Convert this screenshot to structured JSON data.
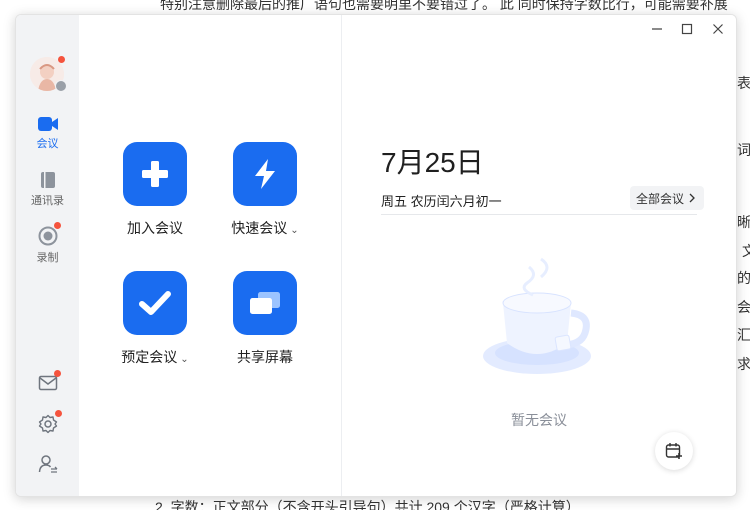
{
  "background_doc": {
    "top_line": "特别注意删除最后的推广语句也需要明里不要错过了。   此 同时保持字数比行，可能需要补展",
    "bottom_line": "2. 字数：正文部分（不含开头引导句）共计 209 个汉字（严格计算）",
    "right_fragments": [
      "表達",
      "词",
      "晰",
      "文",
      "的",
      "会议",
      "汇",
      "求"
    ]
  },
  "window": {
    "controls": {
      "minimize": "minimize-icon",
      "maximize": "maximize-icon",
      "close": "close-icon"
    }
  },
  "sidebar": {
    "avatar": "avatar",
    "items": [
      {
        "label": "会议",
        "icon": "video-camera-icon",
        "active": true
      },
      {
        "label": "通讯录",
        "icon": "contacts-book-icon",
        "active": false
      },
      {
        "label": "录制",
        "icon": "record-icon",
        "active": false
      }
    ],
    "bottom_icons": [
      "mail-icon",
      "settings-gear-icon",
      "user-switch-icon"
    ]
  },
  "actions": [
    {
      "label": "加入会议",
      "icon": "plus-icon",
      "dropdown": false
    },
    {
      "label": "快速会议",
      "icon": "lightning-icon",
      "dropdown": true
    },
    {
      "label": "预定会议",
      "icon": "checkmark-icon",
      "dropdown": true
    },
    {
      "label": "共享屏幕",
      "icon": "share-screen-icon",
      "dropdown": false
    }
  ],
  "calendar": {
    "date": "7月25日",
    "lunar": "周五 农历闰六月初一",
    "all_meetings": "全部会议",
    "empty_text": "暂无会议"
  },
  "colors": {
    "accent": "#1a6cf0",
    "badge": "#f5533d",
    "sidebar_bg": "#f2f3f5"
  }
}
